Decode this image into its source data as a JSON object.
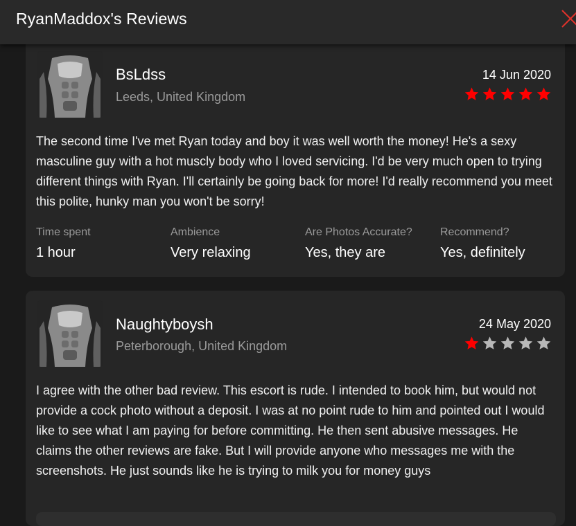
{
  "header": {
    "title": "RyanMaddox's Reviews"
  },
  "colors": {
    "star_filled": "#ff0000",
    "star_empty": "#b8b8b8",
    "close": "#e0322b"
  },
  "reviews": [
    {
      "username": "BsLdss",
      "location": "Leeds, United Kingdom",
      "date": "14 Jun 2020",
      "rating": 5,
      "text": "The second time I've met Ryan today and boy it was well worth the money! He's a sexy masculine guy with a hot muscly body who I loved servicing. I'd be very much open to trying different things with Ryan. I'll certainly be going back for more! I'd really recommend you meet this polite, hunky man you won't be sorry!",
      "stats": [
        {
          "label": "Time spent",
          "value": "1 hour"
        },
        {
          "label": "Ambience",
          "value": "Very relaxing"
        },
        {
          "label": "Are Photos Accurate?",
          "value": "Yes, they are"
        },
        {
          "label": "Recommend?",
          "value": "Yes, definitely"
        }
      ]
    },
    {
      "username": "Naughtyboysh",
      "location": "Peterborough, United Kingdom",
      "date": "24 May 2020",
      "rating": 1,
      "text": "I agree with the other bad review. This escort is rude. I intended to book him, but would not provide a cock photo without a deposit. I was at no point rude to him and pointed out I would like to see what I am paying for before committing. He then sent abusive messages. He claims the other reviews are fake. But I will provide anyone who messages me with the screenshots. He just sounds like he is trying to milk you for money guys"
    }
  ]
}
